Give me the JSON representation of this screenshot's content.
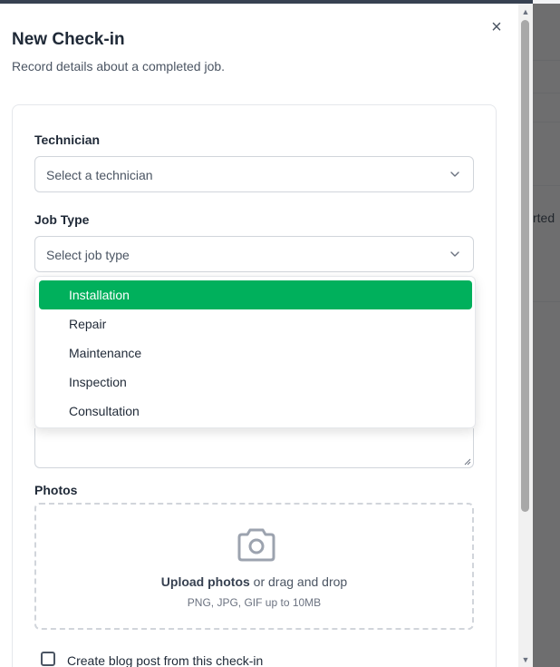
{
  "dialog": {
    "title": "New Check-in",
    "subtitle": "Record details about a completed job.",
    "close_icon": "×"
  },
  "form": {
    "technician": {
      "label": "Technician",
      "placeholder": "Select a technician"
    },
    "job_type": {
      "label": "Job Type",
      "placeholder": "Select job type",
      "options": [
        "Installation",
        "Repair",
        "Maintenance",
        "Inspection",
        "Consultation"
      ],
      "highlighted_option": "Installation"
    },
    "photos": {
      "label": "Photos",
      "upload_action": "Upload photos",
      "upload_rest": " or drag and drop",
      "hint": "PNG, JPG, GIF up to 10MB"
    },
    "blog_checkbox": {
      "label": "Create blog post from this check-in",
      "checked": false
    }
  },
  "background": {
    "fragment": "rted"
  },
  "colors": {
    "accent": "#00b05c",
    "text_primary": "#1f2937",
    "text_secondary": "#4b5563",
    "border": "#d1d5db"
  },
  "icons": {
    "close": "close-icon",
    "select_chevron": "chevron-down-icon",
    "upload": "camera-icon"
  }
}
